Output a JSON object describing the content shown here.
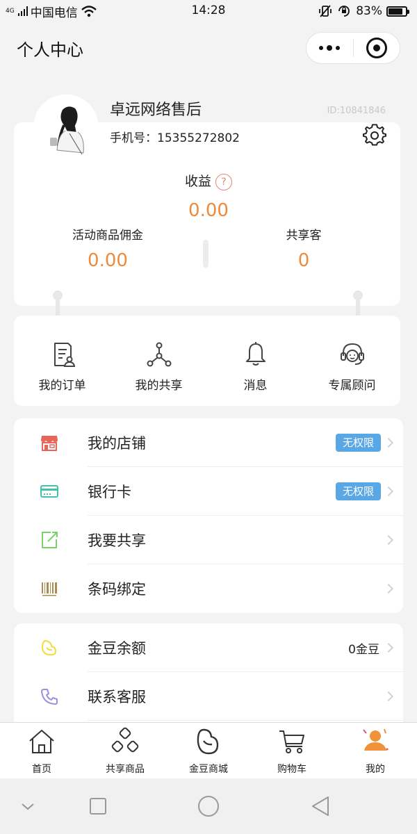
{
  "status_bar": {
    "network": "4G",
    "carrier": "中国电信",
    "time": "14:28",
    "battery": "83%",
    "battery_level": 0.83
  },
  "nav": {
    "title": "个人中心"
  },
  "profile": {
    "name": "卓远网络售后",
    "id": "ID:10841846",
    "phone_label": "手机号：",
    "phone": "15355272802"
  },
  "earnings": {
    "label": "收益",
    "help": "?",
    "value": "0.00",
    "commission_label": "活动商品佣金",
    "commission_value": "0.00",
    "share_label": "共享客",
    "share_value": "0"
  },
  "quick_actions": [
    {
      "label": "我的订单",
      "icon": "order-icon"
    },
    {
      "label": "我的共享",
      "icon": "share-network-icon"
    },
    {
      "label": "消息",
      "icon": "bell-icon"
    },
    {
      "label": "专属顾问",
      "icon": "headset-icon"
    }
  ],
  "menu1": [
    {
      "label": "我的店铺",
      "badge": "无权限",
      "icon": "store-icon",
      "color": "#e8655a"
    },
    {
      "label": "银行卡",
      "badge": "无权限",
      "icon": "bank-card-icon",
      "color": "#3fc4a9"
    },
    {
      "label": "我要共享",
      "icon": "share-out-icon",
      "color": "#7ad36a"
    },
    {
      "label": "条码绑定",
      "icon": "barcode-icon",
      "color": "#a88c52"
    }
  ],
  "menu2": [
    {
      "label": "金豆余额",
      "value": "0金豆",
      "icon": "bean-icon",
      "color": "#f2dc3c"
    },
    {
      "label": "联系客服",
      "icon": "phone-icon",
      "color": "#9b8fe0"
    }
  ],
  "tabs": [
    {
      "label": "首页",
      "icon": "home-icon"
    },
    {
      "label": "共享商品",
      "icon": "shared-goods-icon"
    },
    {
      "label": "金豆商城",
      "icon": "bean-mall-icon"
    },
    {
      "label": "购物车",
      "icon": "cart-icon"
    },
    {
      "label": "我的",
      "icon": "user-icon",
      "active": true,
      "color": "#f0923a"
    }
  ],
  "colors": {
    "accent_orange": "#f08a3b",
    "badge_blue": "#5aa7e6",
    "background": "#f3f3f3"
  }
}
